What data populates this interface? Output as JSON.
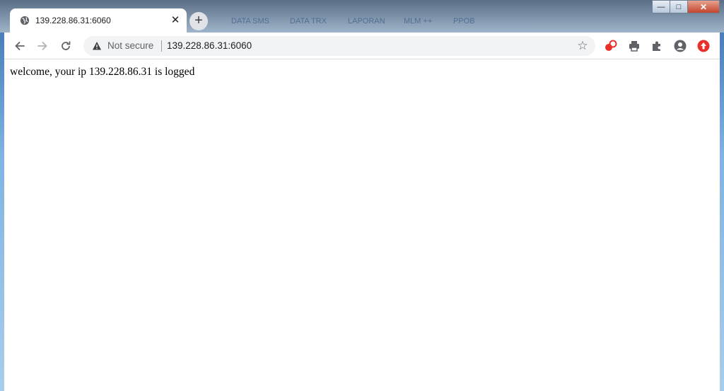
{
  "background": {
    "blurred_tabs": [
      "DATA SMS",
      "DATA TRX",
      "LAPORAN",
      "MLM ++",
      "PPOB"
    ]
  },
  "window": {
    "controls": {
      "minimize_glyph": "—",
      "maximize_glyph": "□",
      "close_glyph": "✕"
    }
  },
  "tab": {
    "title": "139.228.86.31:6060",
    "icon": "globe-icon",
    "close_glyph": "✕"
  },
  "new_tab_glyph": "+",
  "toolbar": {
    "back_icon": "back-arrow-icon",
    "forward_icon": "forward-arrow-icon",
    "reload_icon": "reload-icon",
    "security_label": "Not secure",
    "url": "139.228.86.31:6060",
    "bookmark_icon": "star-icon",
    "extensions": [
      "red-ext-icon",
      "print-icon",
      "puzzle-extensions-icon",
      "profile-icon",
      "red-circle-ext-icon"
    ]
  },
  "page": {
    "message": "welcome, your ip 139.228.86.31 is logged"
  },
  "colors": {
    "accent_red": "#e8312a",
    "text": "#202124",
    "icon_gray": "#5f6368",
    "omnibox_bg": "#f1f3f4"
  }
}
